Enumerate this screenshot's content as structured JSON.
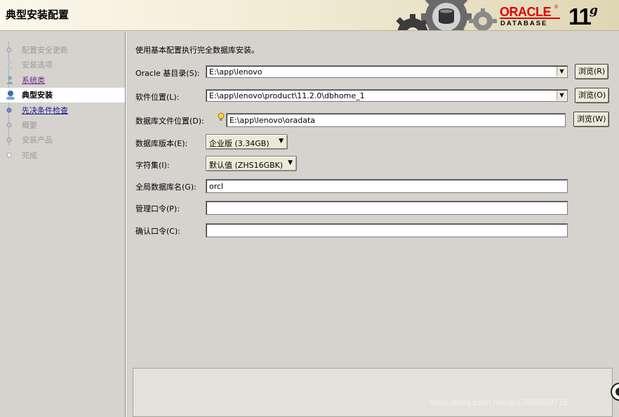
{
  "header": {
    "title": "典型安装配置",
    "logo": {
      "brand": "ORACLE",
      "trademark": "®",
      "product": "DATABASE",
      "version": "11",
      "version_suffix": "g"
    },
    "colors": {
      "brand_red": "#e00000"
    }
  },
  "sidebar": {
    "steps": [
      {
        "label": "配置安全更新",
        "state": "disabled",
        "icon": "step-dot-icon"
      },
      {
        "label": "安装选项",
        "state": "disabled",
        "icon": "step-person-icon"
      },
      {
        "label": "系统类",
        "state": "visited",
        "icon": "step-person-icon"
      },
      {
        "label": "典型安装",
        "state": "current",
        "icon": "step-current-icon"
      },
      {
        "label": "先决条件检查",
        "state": "link",
        "icon": "step-dot-icon"
      },
      {
        "label": "概要",
        "state": "disabled",
        "icon": "step-dot-icon"
      },
      {
        "label": "安装产品",
        "state": "disabled",
        "icon": "step-dot-icon"
      },
      {
        "label": "完成",
        "state": "disabled",
        "icon": "step-ring-icon"
      }
    ]
  },
  "main": {
    "intro": "使用基本配置执行完全数据库安装。",
    "oracle_base": {
      "label": "Oracle 基目录(S):",
      "value": "E:\\app\\lenovo",
      "browse_label": "浏览(R)"
    },
    "software_location": {
      "label": "软件位置(L):",
      "value": "E:\\app\\lenovo\\product\\11.2.0\\dbhome_1",
      "browse_label": "浏览(O)"
    },
    "db_file_location": {
      "label": "数据库文件位置(D):",
      "value": "E:\\app\\lenovo\\oradata",
      "browse_label": "浏览(W)",
      "hint_icon": "lightbulb-icon"
    },
    "db_edition": {
      "label": "数据库版本(E):",
      "value": "企业版 (3.34GB)"
    },
    "charset": {
      "label": "字符集(I):",
      "value": "默认值 (ZHS16GBK)"
    },
    "global_db_name": {
      "label": "全局数据库名(G):",
      "value": "orcl"
    },
    "admin_password": {
      "label": "管理口令(P):",
      "value": ""
    },
    "confirm_password": {
      "label": "确认口令(C):",
      "value": ""
    }
  },
  "watermark": "https://blog.csdn.net/qs17809259715"
}
